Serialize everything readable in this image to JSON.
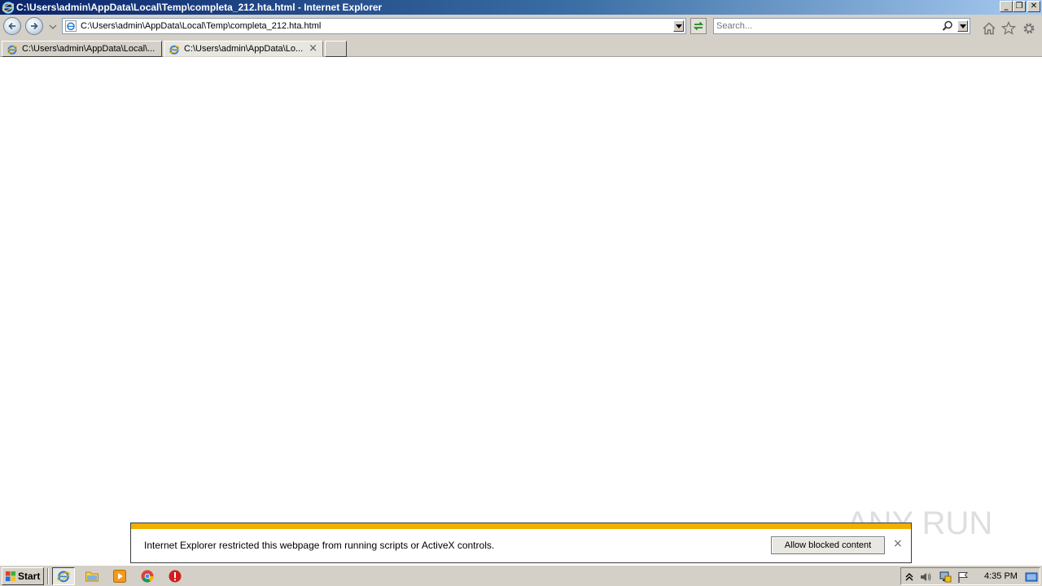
{
  "window": {
    "title": "C:\\Users\\admin\\AppData\\Local\\Temp\\completa_212.hta.html - Internet Explorer",
    "minimize_label": "_",
    "restore_label": "❐",
    "close_label": "✕"
  },
  "navbar": {
    "address": "C:\\Users\\admin\\AppData\\Local\\Temp\\completa_212.hta.html",
    "search_placeholder": "Search..."
  },
  "tabs": [
    {
      "label": "C:\\Users\\admin\\AppData\\Local\\...",
      "active": false
    },
    {
      "label": "C:\\Users\\admin\\AppData\\Lo...",
      "active": true,
      "close": "×"
    }
  ],
  "notification": {
    "message": "Internet Explorer restricted this webpage from running scripts or ActiveX controls.",
    "button_label": "Allow blocked content",
    "close": "×",
    "strip_color": "#f0b000"
  },
  "watermark": {
    "text": "ANY RUN"
  },
  "taskbar": {
    "start_label": "Start",
    "clock": "4:35 PM",
    "icons": [
      "ie-icon",
      "folder-icon",
      "media-player-icon",
      "chrome-icon",
      "stop-icon"
    ]
  },
  "colors": {
    "title_start": "#0a246a",
    "title_end": "#a6caf0",
    "chrome": "#d4d0c8"
  }
}
